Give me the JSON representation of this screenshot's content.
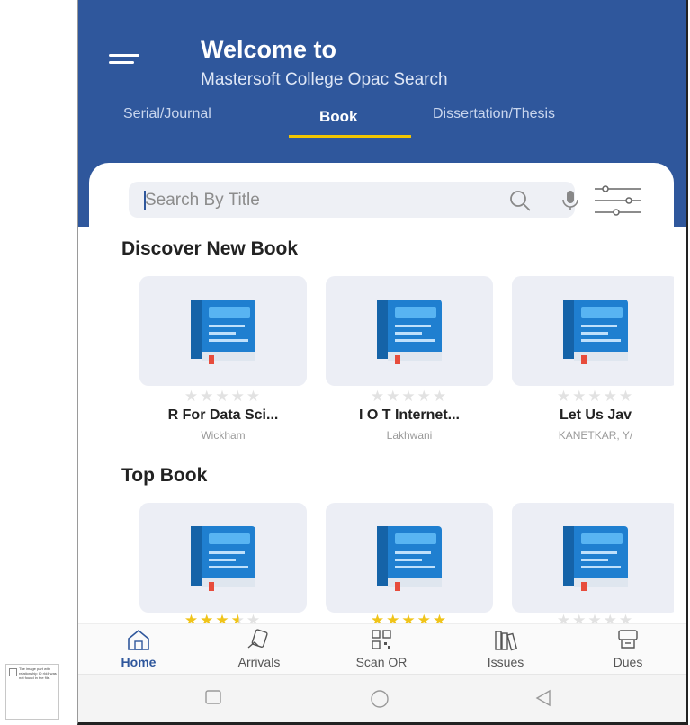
{
  "broken_image_text": "The image part with relationship ID rId4 was not found in the file.",
  "header": {
    "title": "Welcome to",
    "subtitle": "Mastersoft College Opac Search",
    "tabs": [
      {
        "label": "Serial/Journal",
        "active": false
      },
      {
        "label": "Book",
        "active": true
      },
      {
        "label": "Dissertation/Thesis",
        "active": false
      }
    ]
  },
  "search": {
    "placeholder": "Search By Title"
  },
  "sections": {
    "discover": {
      "title": "Discover New Book",
      "books": [
        {
          "title": "R For Data Sci...",
          "author": "Wickham",
          "rating": 0
        },
        {
          "title": "I O T Internet...",
          "author": "Lakhwani",
          "rating": 0
        },
        {
          "title": "Let Us Jav",
          "author": "KANETKAR, Y/",
          "rating": 0
        }
      ]
    },
    "top": {
      "title": "Top Book",
      "books": [
        {
          "rating": 3.5
        },
        {
          "rating": 5
        },
        {
          "rating": 0
        }
      ]
    }
  },
  "bottom_nav": [
    {
      "label": "Home",
      "icon": "home-icon",
      "active": true
    },
    {
      "label": "Arrivals",
      "icon": "arrivals-icon",
      "active": false
    },
    {
      "label": "Scan OR",
      "icon": "qr-scan-icon",
      "active": false
    },
    {
      "label": "Issues",
      "icon": "books-icon",
      "active": false
    },
    {
      "label": "Dues",
      "icon": "payment-icon",
      "active": false
    }
  ],
  "colors": {
    "primary": "#2f579c",
    "accent": "#f2c500",
    "star": "#f0c419",
    "book": "#1f7fd0"
  }
}
